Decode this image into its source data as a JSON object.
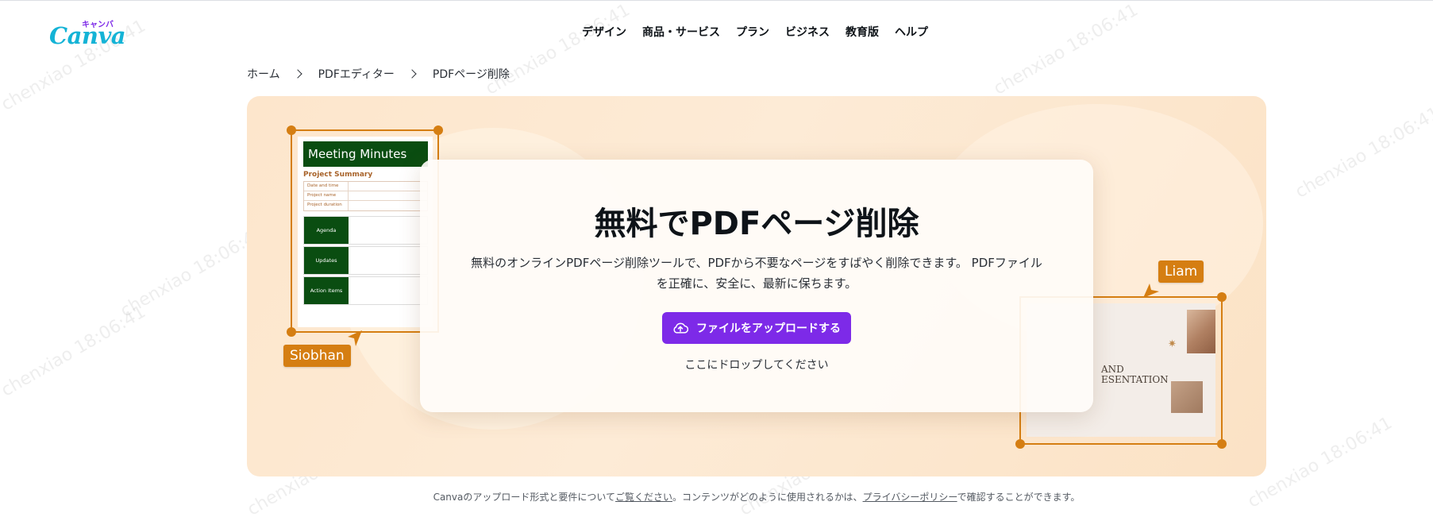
{
  "logo": {
    "main": "Canva",
    "kana": "キャンバ"
  },
  "nav": {
    "items": [
      "デザイン",
      "商品・サービス",
      "プラン",
      "ビジネス",
      "教育版",
      "ヘルプ"
    ]
  },
  "breadcrumb": {
    "items": [
      "ホーム",
      "PDFエディター",
      "PDFページ削除"
    ]
  },
  "hero": {
    "title": "無料でPDFページ削除",
    "description": "無料のオンラインPDFページ削除ツールで、PDFから不要なページをすばやく削除できます。 PDFファイルを正確に、安全に、最新に保ちます。",
    "upload_label": "ファイルをアップロードする",
    "drop_label": "ここにドロップしてください"
  },
  "doc_preview": {
    "title": "Meeting Minutes",
    "subtitle": "Project Summary",
    "rows": [
      "Date and time",
      "Project name",
      "Project duration"
    ],
    "blocks": [
      "Agenda",
      "Updates",
      "Action Items"
    ],
    "cursor_name": "Siobhan"
  },
  "pres_preview": {
    "line1": "AND",
    "line2": "ESENTATION",
    "cursor_name": "Liam"
  },
  "footnote": {
    "prefix": "Canvaのアップロード形式と要件について",
    "link1": "ご覧ください",
    "middle": "。コンテンツがどのように使用されるかは、",
    "link2": "プライバシーポリシー",
    "suffix": "で確認することができます。"
  },
  "watermark": {
    "text": "chenxiao 18:06:41"
  },
  "colors": {
    "accent": "#7d2ae8",
    "frame": "#d57e12",
    "hero_bg": "#fde6cc",
    "doc_green": "#0a4d11"
  }
}
